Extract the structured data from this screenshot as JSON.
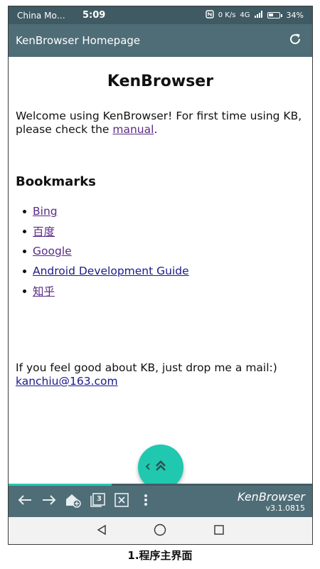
{
  "status_bar": {
    "carrier": "China Mo…",
    "time": "5:09",
    "network_speed": "0 K/s",
    "signal": "4G",
    "battery": "34%"
  },
  "app_bar": {
    "title": "KenBrowser Homepage",
    "refresh_icon": "refresh-icon"
  },
  "page": {
    "title": "KenBrowser",
    "welcome_text_1": "Welcome using KenBrowser!  For first time using KB, please check the ",
    "manual_link": "manual",
    "welcome_text_2": ".",
    "bookmarks_heading": "Bookmarks",
    "bookmarks": [
      {
        "label": "Bing"
      },
      {
        "label": "百度"
      },
      {
        "label": "Google"
      },
      {
        "label": "Android Development Guide"
      },
      {
        "label": "知乎"
      }
    ],
    "mail_text": "If you feel good about KB, just drop me a mail:)",
    "mail_link": "kanchiu@163.com"
  },
  "fab": {
    "icon": "chevron-double-up-icon",
    "small_icon": "chevron-left-icon"
  },
  "progress": {
    "fraction": 0.34
  },
  "toolbar": {
    "back_icon": "arrow-left-icon",
    "forward_icon": "arrow-right-icon",
    "add_home_icon": "home-add-icon",
    "tabs_count": "3",
    "close_icon": "close-tab-icon",
    "menu_icon": "more-vert-icon",
    "brand_name": "KenBrowser",
    "version": "v3.1.0815"
  },
  "nav_bar": {
    "back_icon": "triangle-back-icon",
    "home_icon": "circle-home-icon",
    "recents_icon": "square-recents-icon"
  },
  "caption": "1.程序主界面",
  "colors": {
    "status_bar": "#3f5a63",
    "app_bar": "#4f6d77",
    "fab": "#20c8b0",
    "link": "#1a1a8c"
  }
}
